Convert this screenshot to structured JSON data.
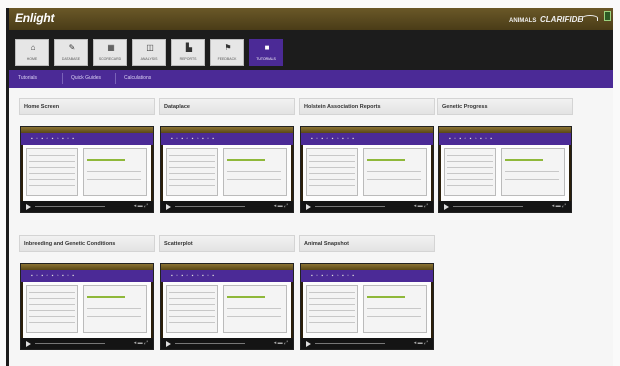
{
  "app": {
    "logo": "Enlight",
    "brand_small": "ANIMALS",
    "brand_name": "CLARIFIDE"
  },
  "toolbar": {
    "buttons": [
      {
        "label": "HOME",
        "icon": "home-icon",
        "glyph": "⌂"
      },
      {
        "label": "DATABASE",
        "icon": "wrench-icon",
        "glyph": "✎"
      },
      {
        "label": "SCORECARD",
        "icon": "scorecard-icon",
        "glyph": "▦"
      },
      {
        "label": "ANALYSIS",
        "icon": "analysis-icon",
        "glyph": "◫"
      },
      {
        "label": "REPORTS",
        "icon": "chart-icon",
        "glyph": "▙"
      },
      {
        "label": "FEEDBACK",
        "icon": "flag-icon",
        "glyph": "⚑"
      },
      {
        "label": "TUTORIALS",
        "icon": "video-icon",
        "glyph": "■"
      }
    ]
  },
  "subnav": {
    "items": [
      "Tutorials",
      "Quick Guides",
      "Calculations"
    ]
  },
  "cards": [
    {
      "title": "Home Screen"
    },
    {
      "title": "Dataplace"
    },
    {
      "title": "Holstein Association Reports"
    },
    {
      "title": "Genetic Progress"
    },
    {
      "title": "Inbreeding and Genetic Conditions"
    },
    {
      "title": "Scatterplot"
    },
    {
      "title": "Animal Snapshot"
    }
  ],
  "colors": {
    "header": "#5c4a1e",
    "toolbar": "#1c1c1c",
    "accent_purple": "#4b2a96",
    "bar_green": "#8fb83a"
  }
}
